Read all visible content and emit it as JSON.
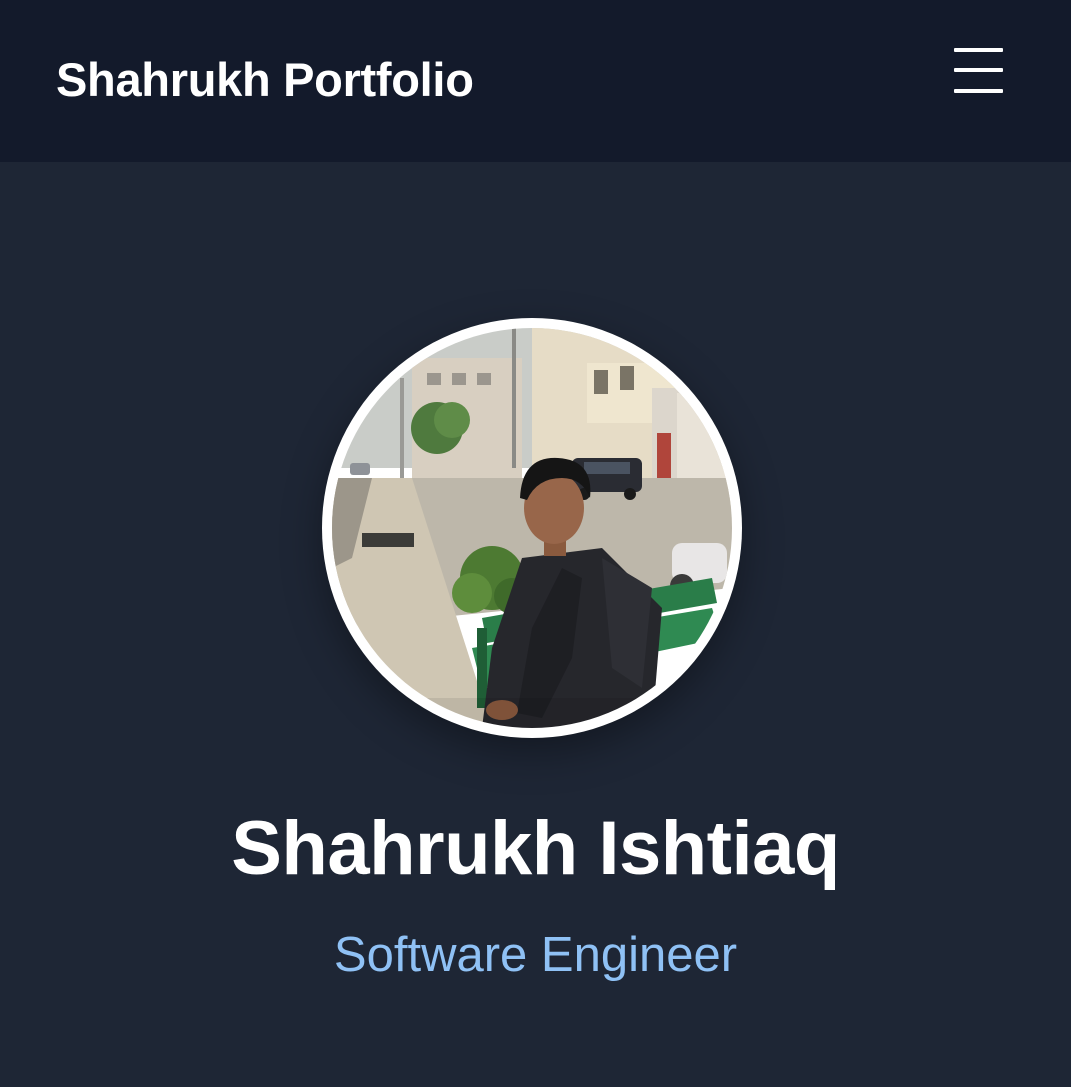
{
  "header": {
    "brand": "Shahrukh Portfolio",
    "menu_icon": "hamburger-menu-icon"
  },
  "profile": {
    "name": "Shahrukh Ishtiaq",
    "role": "Software Engineer",
    "photo_alt": "profile-photo"
  },
  "colors": {
    "navbar_bg": "#131a2b",
    "page_bg": "#1e2635",
    "name_text": "#ffffff",
    "role_text": "#8fc1f5",
    "ring": "#ffffff"
  }
}
